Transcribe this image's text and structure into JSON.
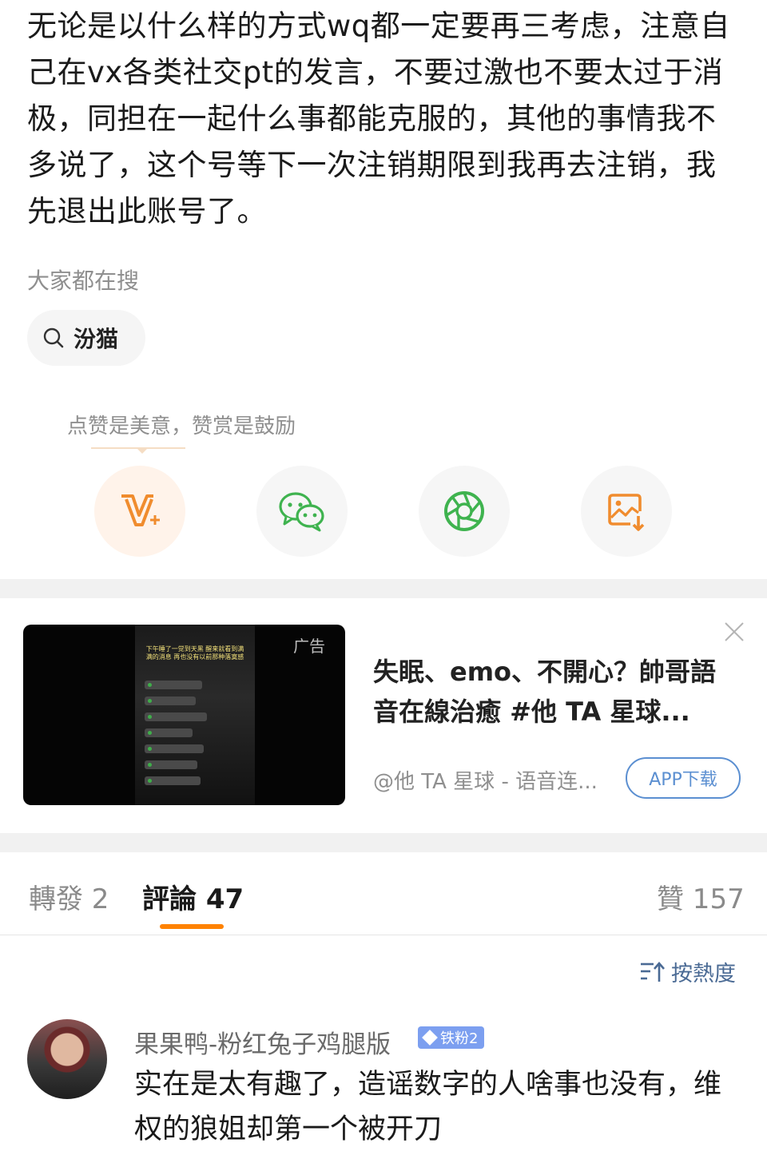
{
  "post": {
    "body": "无论是以什么样的方式wq都一定要再三考虑，注意自己在vx各类社交pt的发言，不要过激也不要太过于消极，同担在一起什么事都能克服的，其他的事情我不多说了，这个号等下一次注销期限到我再去注销，我先退出此账号了。"
  },
  "trending": {
    "title": "大家都在搜",
    "chip_label": "汾猫",
    "chip_icon": "search-icon"
  },
  "share": {
    "tip": "点赞是美意，赞赏是鼓励",
    "buttons": [
      {
        "name": "reward",
        "icon": "v-plus-icon",
        "color": "#f08c2e"
      },
      {
        "name": "wechat",
        "icon": "wechat-icon",
        "color": "#3fb34f"
      },
      {
        "name": "moments",
        "icon": "aperture-icon",
        "color": "#3fb34f"
      },
      {
        "name": "save-image",
        "icon": "image-download-icon",
        "color": "#f08c2e"
      }
    ]
  },
  "ad": {
    "label": "广告",
    "thumb_caption": "下午睡了一觉到天黑 醒来就看到满满的消息 再也没有以前那种落寞感",
    "title": "失眠、emo、不開心？帥哥語音在線治癒 #他 TA 星球...",
    "source": "@他 TA 星球 - 语音连...",
    "cta": "APP下载",
    "close_icon": "close-icon"
  },
  "tabs": {
    "repost": "轉發 2",
    "comments": "評論 47",
    "likes": "贊 157"
  },
  "sort": {
    "label": "按熱度",
    "icon": "sort-icon"
  },
  "comment": {
    "username": "果果鸭-粉红兔子鸡腿版",
    "badge": "铁粉2",
    "text": "实在是太有趣了，造谣数字的人啥事也没有，维权的狼姐却第一个被开刀"
  },
  "colors": {
    "accent": "#ff8200",
    "link": "#5b8fd1",
    "badge": "#7c9ff0"
  }
}
